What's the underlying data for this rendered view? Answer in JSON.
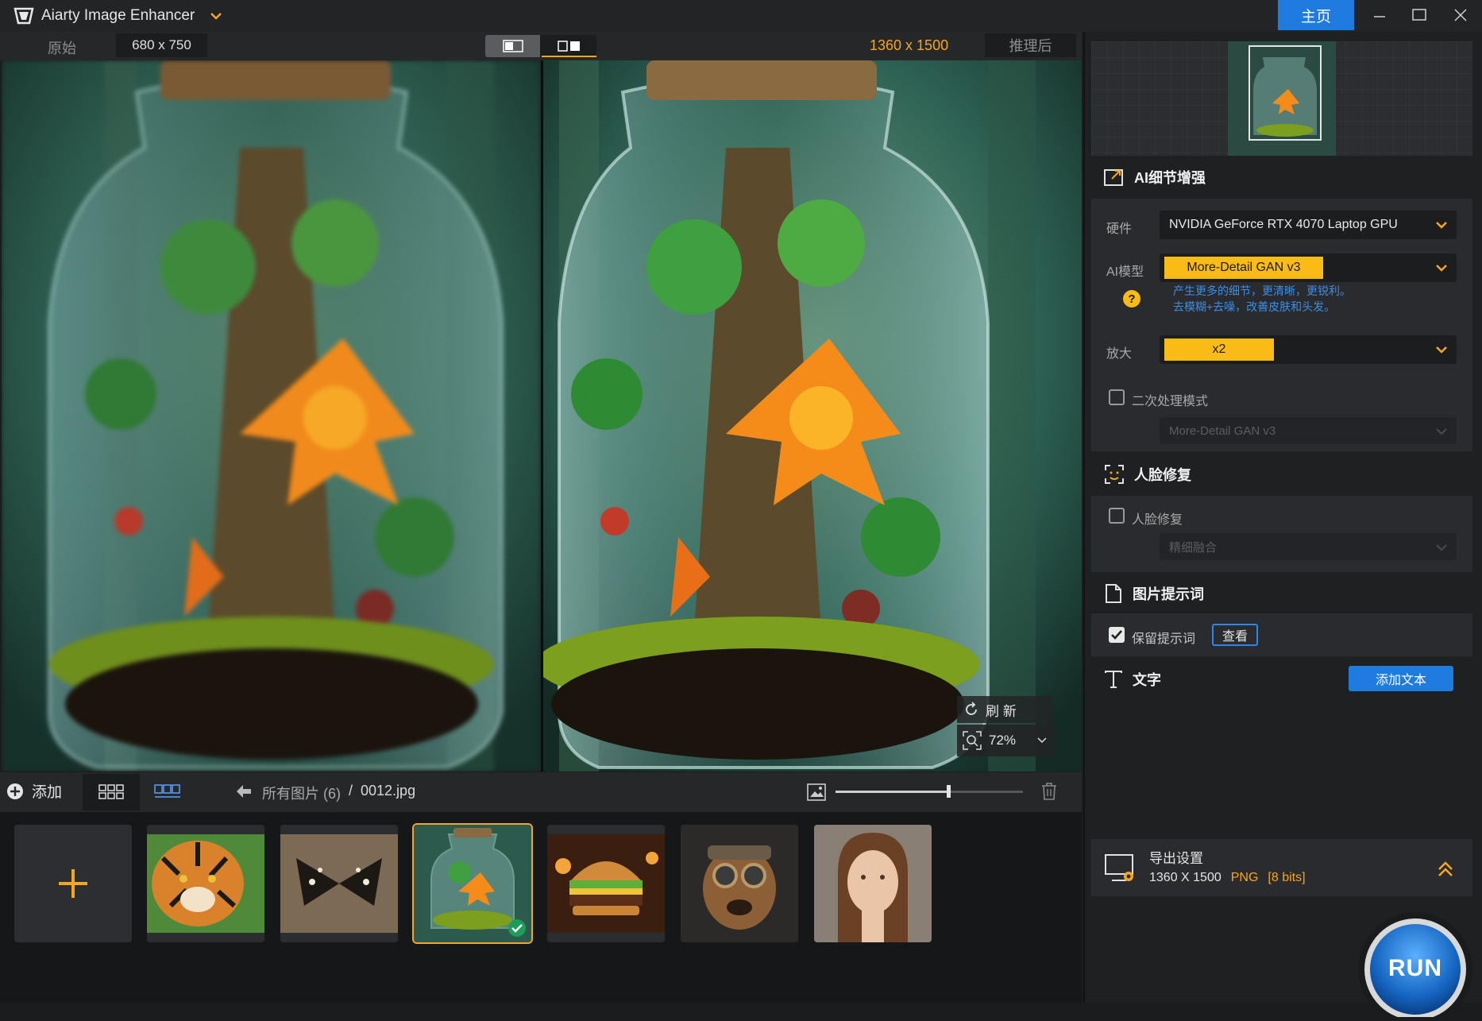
{
  "app": {
    "title": "Aiarty Image Enhancer",
    "home_label": "主页"
  },
  "preview": {
    "original_label": "原始",
    "original_size": "680 x 750",
    "output_size": "1360 x 1500",
    "after_label": "推理后",
    "refresh_label": "刷 新",
    "zoom": "72%"
  },
  "toolbar": {
    "add_label": "添加",
    "breadcrumb_all": "所有图片 (6)",
    "breadcrumb_sep": "/",
    "breadcrumb_file": "0012.jpg",
    "slider_value": 0.6
  },
  "thumbnails": [
    {
      "name": "tiger",
      "selected": false
    },
    {
      "name": "butterfly",
      "selected": false
    },
    {
      "name": "jar",
      "selected": true
    },
    {
      "name": "burger",
      "selected": false
    },
    {
      "name": "dog",
      "selected": false
    },
    {
      "name": "girl",
      "selected": false
    }
  ],
  "panel": {
    "ai_detail": {
      "title": "AI细节增强",
      "hardware_label": "硬件",
      "hardware_value": "NVIDIA GeForce RTX 4070 Laptop GPU",
      "model_label": "AI模型",
      "model_value": "More-Detail GAN  v3",
      "model_desc_1": "产生更多的细节，更清晰，更锐利。",
      "model_desc_2": "去模糊+去噪，改善皮肤和头发。",
      "upscale_label": "放大",
      "upscale_value": "x2",
      "secondary_label": "二次处理模式",
      "secondary_model": "More-Detail GAN  v3"
    },
    "face": {
      "title": "人脸修复",
      "checkbox_label": "人脸修复",
      "mode": "精细融合"
    },
    "prompt": {
      "title": "图片提示词",
      "keep_label": "保留提示词",
      "view_label": "查看"
    },
    "text": {
      "title": "文字",
      "add_label": "添加文本"
    },
    "export": {
      "title": "导出设置",
      "size": "1360 X 1500",
      "format": "PNG",
      "bits": "[8 bits]"
    },
    "run_label": "RUN"
  },
  "colors": {
    "accent": "#f5a623",
    "blue": "#1f7be0",
    "yellow": "#fbbb17"
  }
}
